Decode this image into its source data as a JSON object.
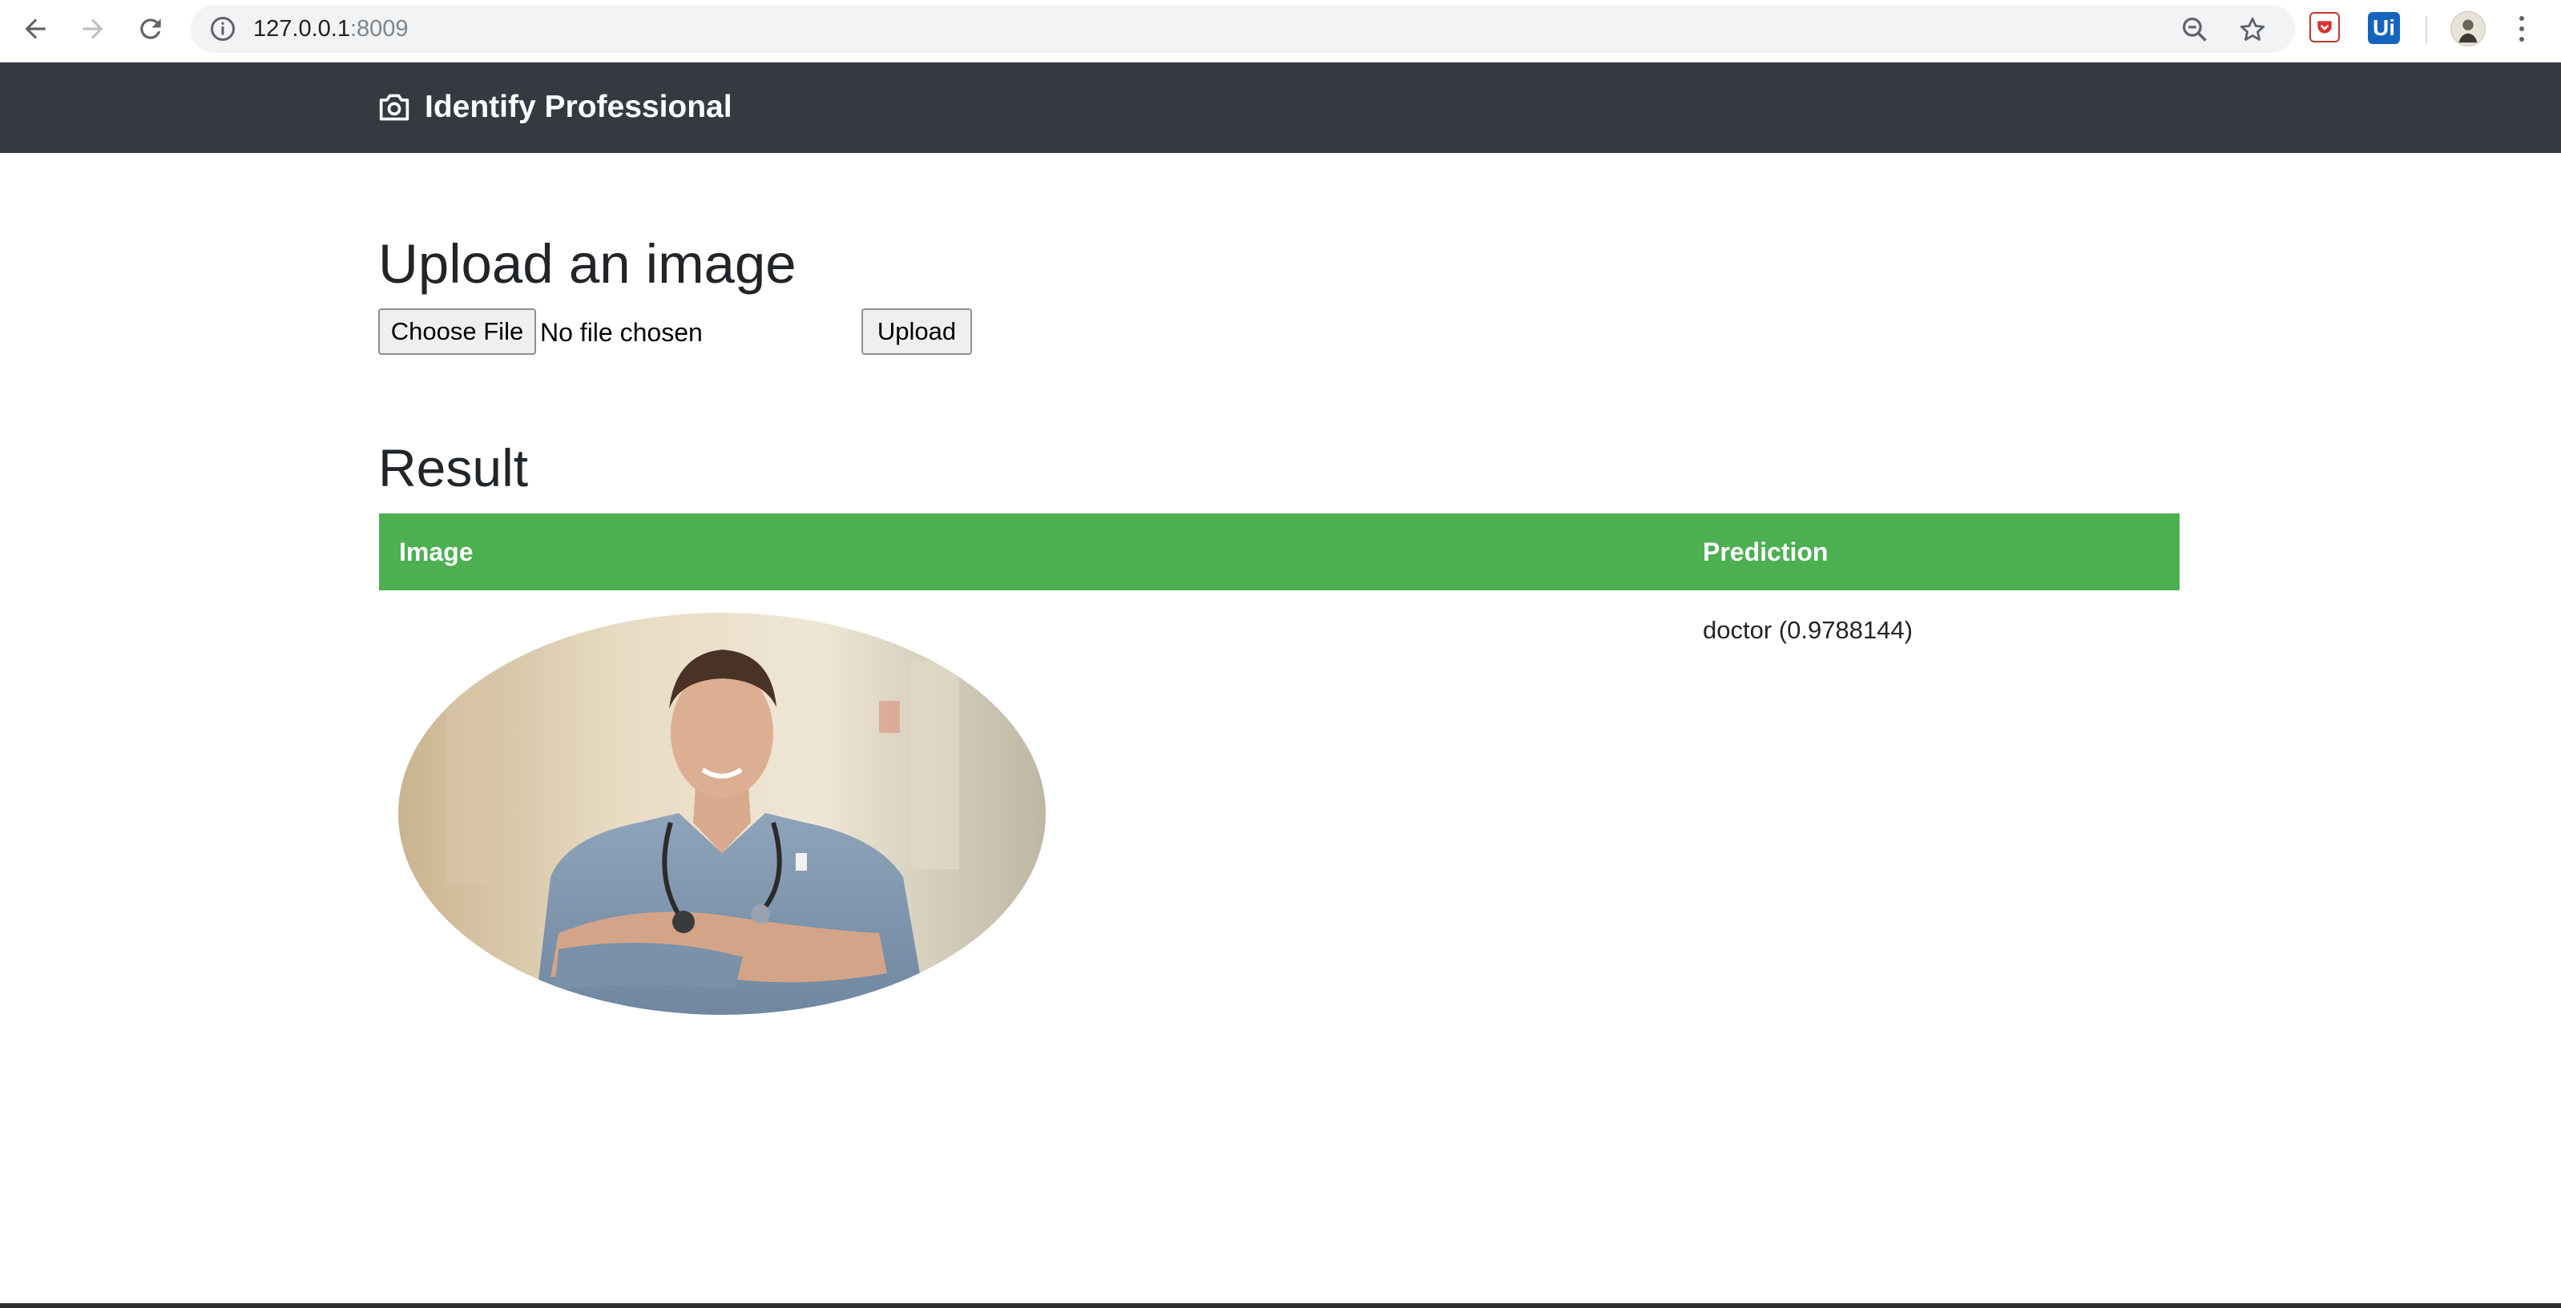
{
  "browser": {
    "url_host": "127.0.0.1",
    "url_port": ":8009",
    "icons": [
      "back-arrow-icon",
      "forward-arrow-icon",
      "reload-icon",
      "info-icon",
      "zoom-icon",
      "star-icon",
      "pocket-extension-icon",
      "uipath-extension-icon",
      "profile-avatar",
      "menu-dots-icon"
    ],
    "ext_ui_label": "Ui"
  },
  "navbar": {
    "brand": "Identify Professional",
    "icon": "camera-icon",
    "background": "#343a40"
  },
  "upload": {
    "heading": "Upload an image",
    "choose_label": "Choose File",
    "file_status": "No file chosen",
    "upload_label": "Upload"
  },
  "result": {
    "heading": "Result",
    "header_color": "#4caf50",
    "columns": [
      "Image",
      "Prediction"
    ],
    "rows": [
      {
        "image": "doctor-photo",
        "prediction": "doctor (0.9788144)"
      }
    ]
  }
}
